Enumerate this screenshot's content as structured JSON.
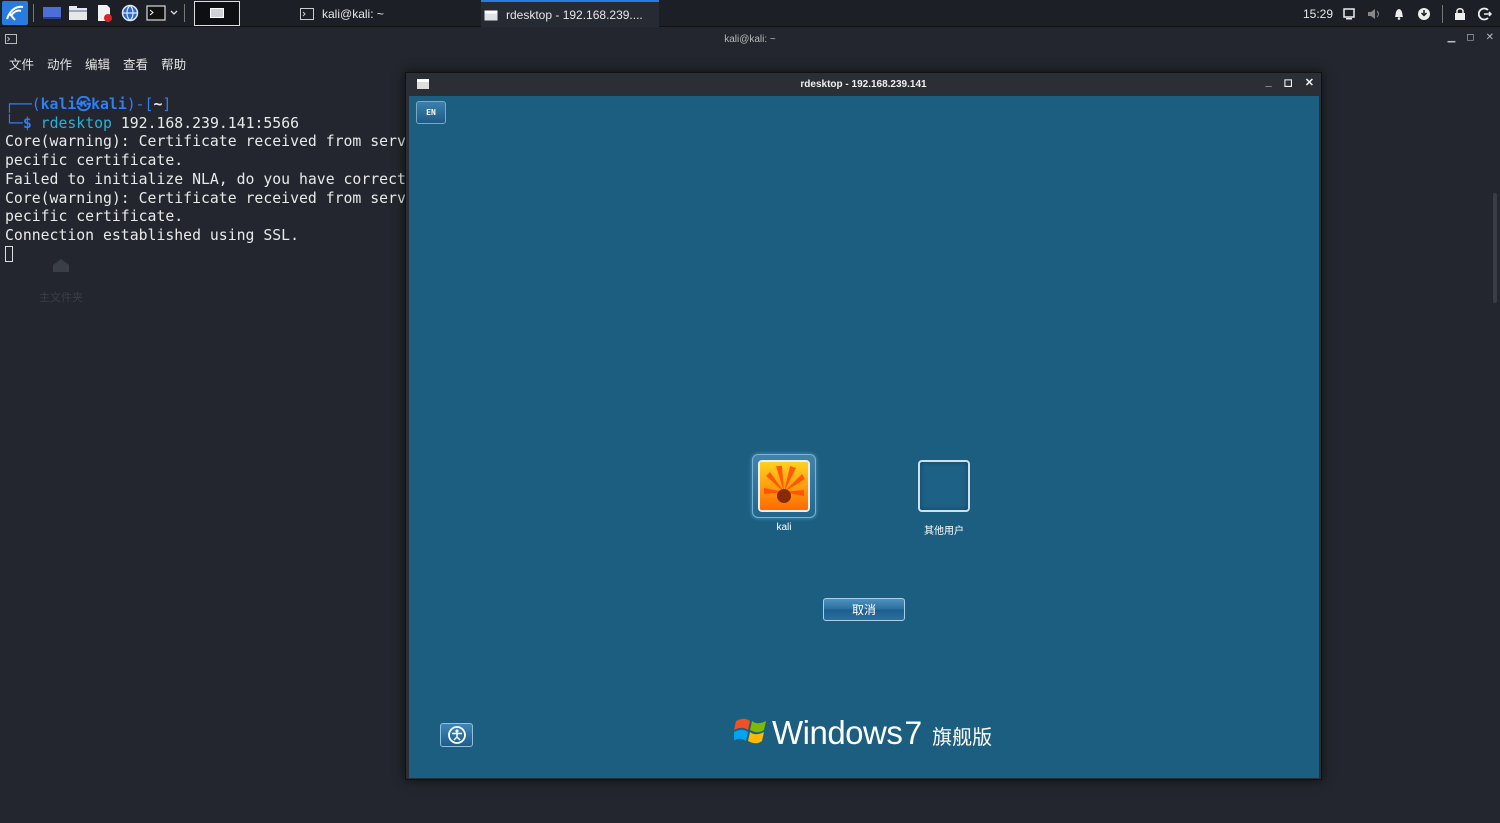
{
  "taskbar": {
    "tasks": [
      {
        "label": "kali@kali: ~"
      },
      {
        "label": "rdesktop - 192.168.239...."
      }
    ],
    "clock": "15:29"
  },
  "terminal": {
    "title": "kali@kali: ~",
    "menu": [
      "文件",
      "动作",
      "编辑",
      "查看",
      "帮助"
    ],
    "prompt_user": "kali",
    "prompt_at": "㉿",
    "prompt_host": "kali",
    "prompt_dir": "~",
    "command": "rdesktop",
    "command_args": "192.168.239.141:5566",
    "output": [
      "Core(warning): Certificate received from serv",
      "pecific certificate.",
      "Failed to initialize NLA, do you have correct",
      "Core(warning): Certificate received from serv",
      "pecific certificate.",
      "Connection established using SSL."
    ],
    "ghost_label": "主文件夹"
  },
  "rdesktop": {
    "title": "rdesktop - 192.168.239.141",
    "lang_button": "EN",
    "users": [
      {
        "name": "kali"
      },
      {
        "name": "其他用户"
      }
    ],
    "cancel_label": "取消",
    "brand_word": "Windows",
    "brand_version": "7",
    "brand_edition": "旗舰版"
  },
  "colors": {
    "accent": "#2a7bde",
    "win7_background": "#1b5e80",
    "prompt_blue": "#2f7ff2"
  }
}
